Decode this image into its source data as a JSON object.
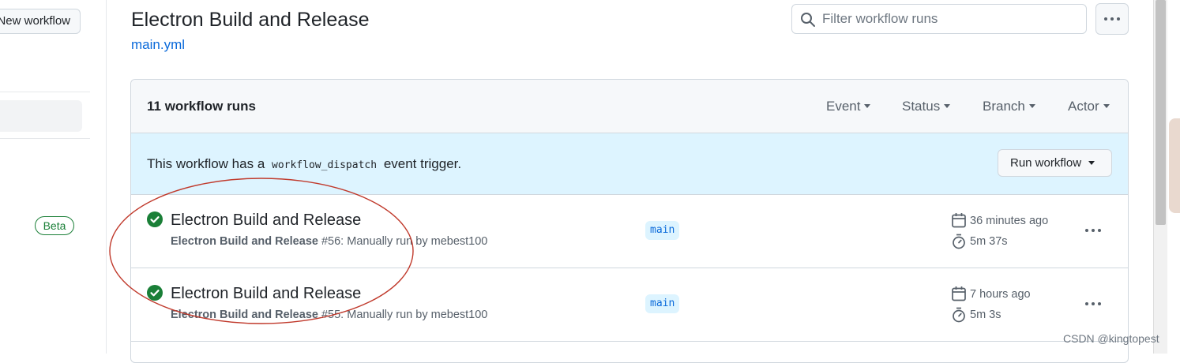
{
  "sidebar": {
    "new_workflow_label": "New workflow",
    "beta_badge": "Beta"
  },
  "header": {
    "title": "Electron Build and Release",
    "file_link": "main.yml",
    "filter_placeholder": "Filter workflow runs"
  },
  "panel": {
    "runs_count": "11 workflow runs",
    "filters": [
      "Event",
      "Status",
      "Branch",
      "Actor"
    ],
    "dispatch": {
      "text_before": "This workflow has a",
      "code": "workflow_dispatch",
      "text_after": "event trigger.",
      "button_label": "Run workflow"
    },
    "runs": [
      {
        "title": "Electron Build and Release",
        "workflow_name": "Electron Build and Release",
        "meta": "#56: Manually run by mebest100",
        "branch": "main",
        "time_ago": "36 minutes ago",
        "duration": "5m 37s",
        "status": "success"
      },
      {
        "title": "Electron Build and Release",
        "workflow_name": "Electron Build and Release",
        "meta": "#55: Manually run by mebest100",
        "branch": "main",
        "time_ago": "7 hours ago",
        "duration": "5m 3s",
        "status": "success"
      }
    ]
  },
  "watermark": "CSDN @kingtopest",
  "colors": {
    "success": "#1a7f37",
    "link": "#0969da",
    "annotation": "#c0392b",
    "dispatch_bg": "#ddf4ff"
  },
  "icons": [
    "search-icon",
    "kebab-icon",
    "check-circle-icon",
    "calendar-icon",
    "stopwatch-icon",
    "caret-down-icon"
  ]
}
